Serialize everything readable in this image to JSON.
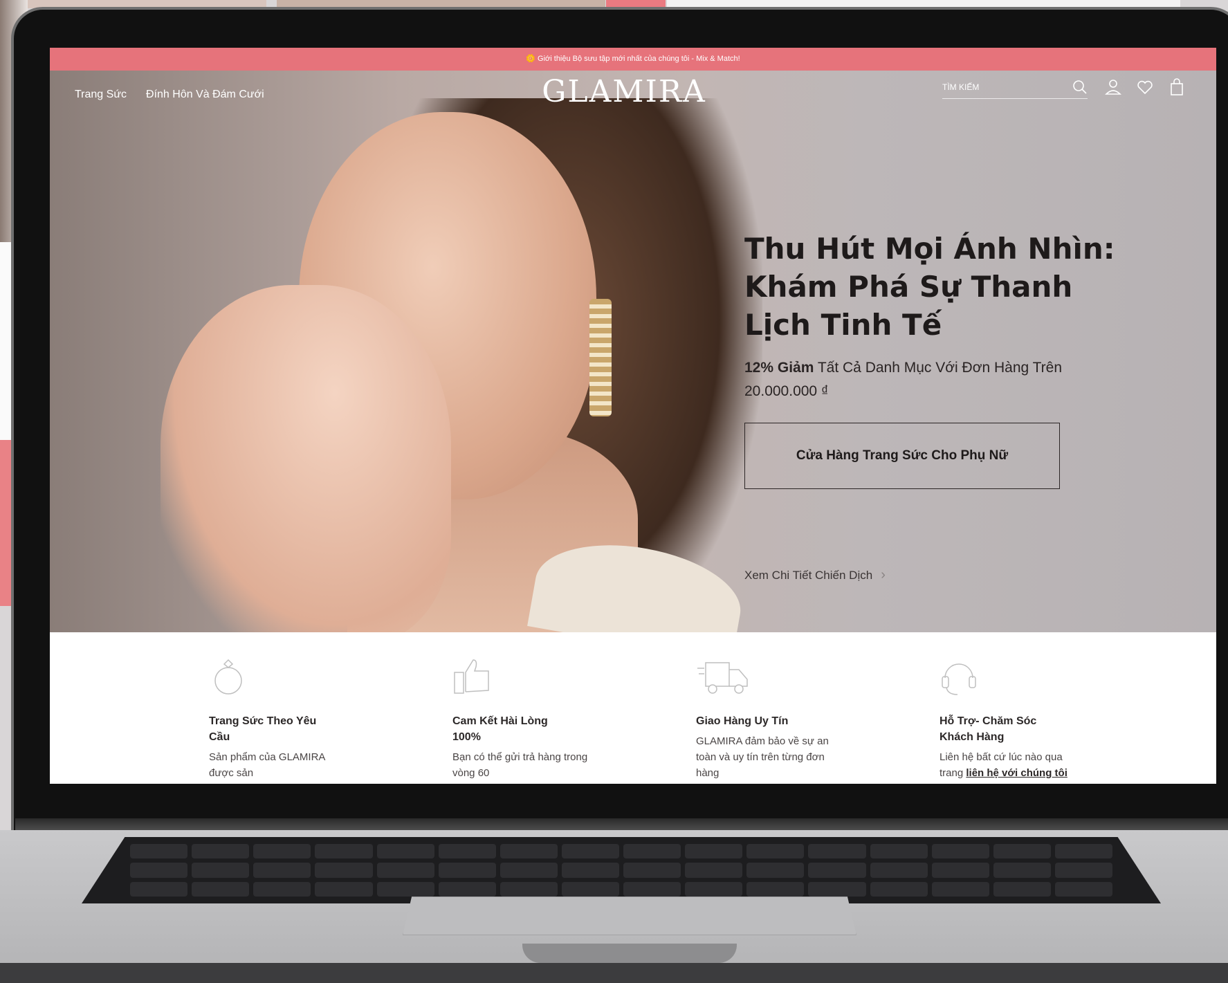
{
  "announcement": {
    "text": "🌼 Giới thiệu Bộ sưu tập mới nhất của chúng tôi - Mix & Match!"
  },
  "nav": {
    "links": [
      "Trang Sức",
      "Đính Hôn Và Đám Cưới"
    ],
    "logo": "GLAMIRA",
    "search_placeholder": "TÌM KIẾM",
    "icons": [
      "search-icon",
      "account-icon",
      "wishlist-heart-icon",
      "shopping-bag-icon"
    ]
  },
  "hero": {
    "title": "Thu Hút Mọi Ánh Nhìn: Khám Phá Sự Thanh Lịch Tinh Tế",
    "subtitle_bold": "12% Giảm",
    "subtitle_rest": " Tất Cả Danh Mục Với Đơn Hàng Trên 20.000.000 ₫",
    "cta_label": "Cửa Hàng Trang Sức Cho Phụ Nữ",
    "campaign_link": "Xem Chi Tiết Chiến Dịch",
    "campaign_arrow": "›"
  },
  "features": [
    {
      "icon": "ring-icon",
      "title": "Trang Sức Theo Yêu Cầu",
      "text": "Sản phẩm của GLAMIRA được sản"
    },
    {
      "icon": "thumbs-up-icon",
      "title": "Cam Kết Hài Lòng 100%",
      "text": "Bạn có thể gửi trả hàng trong vòng 60"
    },
    {
      "icon": "delivery-truck-icon",
      "title": "Giao Hàng Uy Tín",
      "text": "GLAMIRA đảm bảo về sự an toàn và uy tín trên từng đơn hàng"
    },
    {
      "icon": "headset-icon",
      "title": "Hỗ Trợ- Chăm Sóc Khách Hàng",
      "text": "Liên hệ bất cứ lúc nào qua trang ",
      "link": "liên hệ với chúng tôi"
    }
  ],
  "colors": {
    "announcement_bg": "#e6737b",
    "text_dark": "#1e1a1a"
  }
}
